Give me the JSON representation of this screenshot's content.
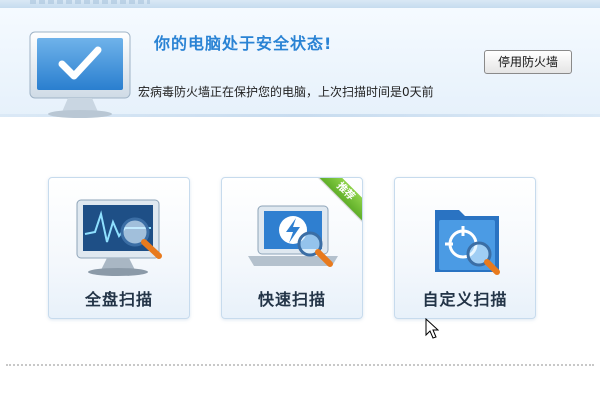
{
  "banner": {
    "status_title": "你的电脑处于安全状态!",
    "status_description": "宏病毒防火墙正在保护您的电脑，上次扫描时间是0天前",
    "firewall_button_label": "停用防火墙",
    "status_icon": "monitor-check-icon"
  },
  "scan_options": [
    {
      "label": "全盘扫描",
      "icon": "monitor-magnifier-icon",
      "badge": null
    },
    {
      "label": "快速扫描",
      "icon": "laptop-lightning-icon",
      "badge": "推荐"
    },
    {
      "label": "自定义扫描",
      "icon": "folder-target-icon",
      "badge": null
    }
  ],
  "colors": {
    "title_blue": "#2a83d4",
    "badge_green": "#6dbb31",
    "card_border": "#c7dbed"
  }
}
